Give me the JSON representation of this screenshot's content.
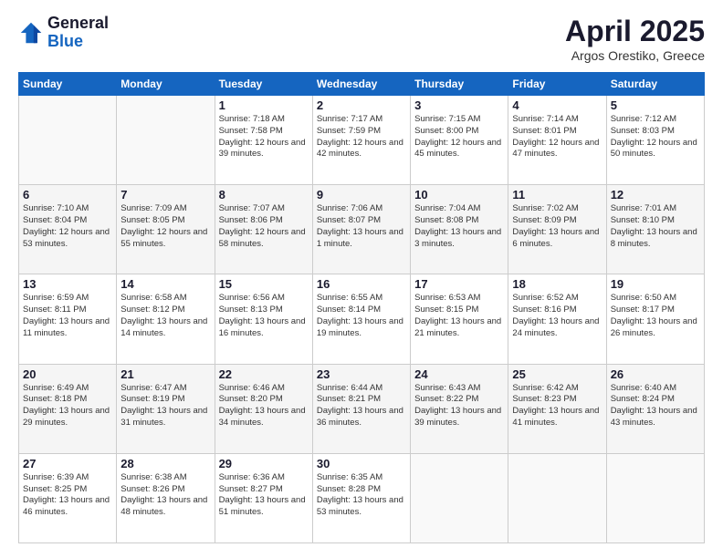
{
  "header": {
    "logo_general": "General",
    "logo_blue": "Blue",
    "month_year": "April 2025",
    "location": "Argos Orestiko, Greece"
  },
  "weekdays": [
    "Sunday",
    "Monday",
    "Tuesday",
    "Wednesday",
    "Thursday",
    "Friday",
    "Saturday"
  ],
  "weeks": [
    [
      {
        "day": "",
        "info": ""
      },
      {
        "day": "",
        "info": ""
      },
      {
        "day": "1",
        "info": "Sunrise: 7:18 AM\nSunset: 7:58 PM\nDaylight: 12 hours and 39 minutes."
      },
      {
        "day": "2",
        "info": "Sunrise: 7:17 AM\nSunset: 7:59 PM\nDaylight: 12 hours and 42 minutes."
      },
      {
        "day": "3",
        "info": "Sunrise: 7:15 AM\nSunset: 8:00 PM\nDaylight: 12 hours and 45 minutes."
      },
      {
        "day": "4",
        "info": "Sunrise: 7:14 AM\nSunset: 8:01 PM\nDaylight: 12 hours and 47 minutes."
      },
      {
        "day": "5",
        "info": "Sunrise: 7:12 AM\nSunset: 8:03 PM\nDaylight: 12 hours and 50 minutes."
      }
    ],
    [
      {
        "day": "6",
        "info": "Sunrise: 7:10 AM\nSunset: 8:04 PM\nDaylight: 12 hours and 53 minutes."
      },
      {
        "day": "7",
        "info": "Sunrise: 7:09 AM\nSunset: 8:05 PM\nDaylight: 12 hours and 55 minutes."
      },
      {
        "day": "8",
        "info": "Sunrise: 7:07 AM\nSunset: 8:06 PM\nDaylight: 12 hours and 58 minutes."
      },
      {
        "day": "9",
        "info": "Sunrise: 7:06 AM\nSunset: 8:07 PM\nDaylight: 13 hours and 1 minute."
      },
      {
        "day": "10",
        "info": "Sunrise: 7:04 AM\nSunset: 8:08 PM\nDaylight: 13 hours and 3 minutes."
      },
      {
        "day": "11",
        "info": "Sunrise: 7:02 AM\nSunset: 8:09 PM\nDaylight: 13 hours and 6 minutes."
      },
      {
        "day": "12",
        "info": "Sunrise: 7:01 AM\nSunset: 8:10 PM\nDaylight: 13 hours and 8 minutes."
      }
    ],
    [
      {
        "day": "13",
        "info": "Sunrise: 6:59 AM\nSunset: 8:11 PM\nDaylight: 13 hours and 11 minutes."
      },
      {
        "day": "14",
        "info": "Sunrise: 6:58 AM\nSunset: 8:12 PM\nDaylight: 13 hours and 14 minutes."
      },
      {
        "day": "15",
        "info": "Sunrise: 6:56 AM\nSunset: 8:13 PM\nDaylight: 13 hours and 16 minutes."
      },
      {
        "day": "16",
        "info": "Sunrise: 6:55 AM\nSunset: 8:14 PM\nDaylight: 13 hours and 19 minutes."
      },
      {
        "day": "17",
        "info": "Sunrise: 6:53 AM\nSunset: 8:15 PM\nDaylight: 13 hours and 21 minutes."
      },
      {
        "day": "18",
        "info": "Sunrise: 6:52 AM\nSunset: 8:16 PM\nDaylight: 13 hours and 24 minutes."
      },
      {
        "day": "19",
        "info": "Sunrise: 6:50 AM\nSunset: 8:17 PM\nDaylight: 13 hours and 26 minutes."
      }
    ],
    [
      {
        "day": "20",
        "info": "Sunrise: 6:49 AM\nSunset: 8:18 PM\nDaylight: 13 hours and 29 minutes."
      },
      {
        "day": "21",
        "info": "Sunrise: 6:47 AM\nSunset: 8:19 PM\nDaylight: 13 hours and 31 minutes."
      },
      {
        "day": "22",
        "info": "Sunrise: 6:46 AM\nSunset: 8:20 PM\nDaylight: 13 hours and 34 minutes."
      },
      {
        "day": "23",
        "info": "Sunrise: 6:44 AM\nSunset: 8:21 PM\nDaylight: 13 hours and 36 minutes."
      },
      {
        "day": "24",
        "info": "Sunrise: 6:43 AM\nSunset: 8:22 PM\nDaylight: 13 hours and 39 minutes."
      },
      {
        "day": "25",
        "info": "Sunrise: 6:42 AM\nSunset: 8:23 PM\nDaylight: 13 hours and 41 minutes."
      },
      {
        "day": "26",
        "info": "Sunrise: 6:40 AM\nSunset: 8:24 PM\nDaylight: 13 hours and 43 minutes."
      }
    ],
    [
      {
        "day": "27",
        "info": "Sunrise: 6:39 AM\nSunset: 8:25 PM\nDaylight: 13 hours and 46 minutes."
      },
      {
        "day": "28",
        "info": "Sunrise: 6:38 AM\nSunset: 8:26 PM\nDaylight: 13 hours and 48 minutes."
      },
      {
        "day": "29",
        "info": "Sunrise: 6:36 AM\nSunset: 8:27 PM\nDaylight: 13 hours and 51 minutes."
      },
      {
        "day": "30",
        "info": "Sunrise: 6:35 AM\nSunset: 8:28 PM\nDaylight: 13 hours and 53 minutes."
      },
      {
        "day": "",
        "info": ""
      },
      {
        "day": "",
        "info": ""
      },
      {
        "day": "",
        "info": ""
      }
    ]
  ]
}
